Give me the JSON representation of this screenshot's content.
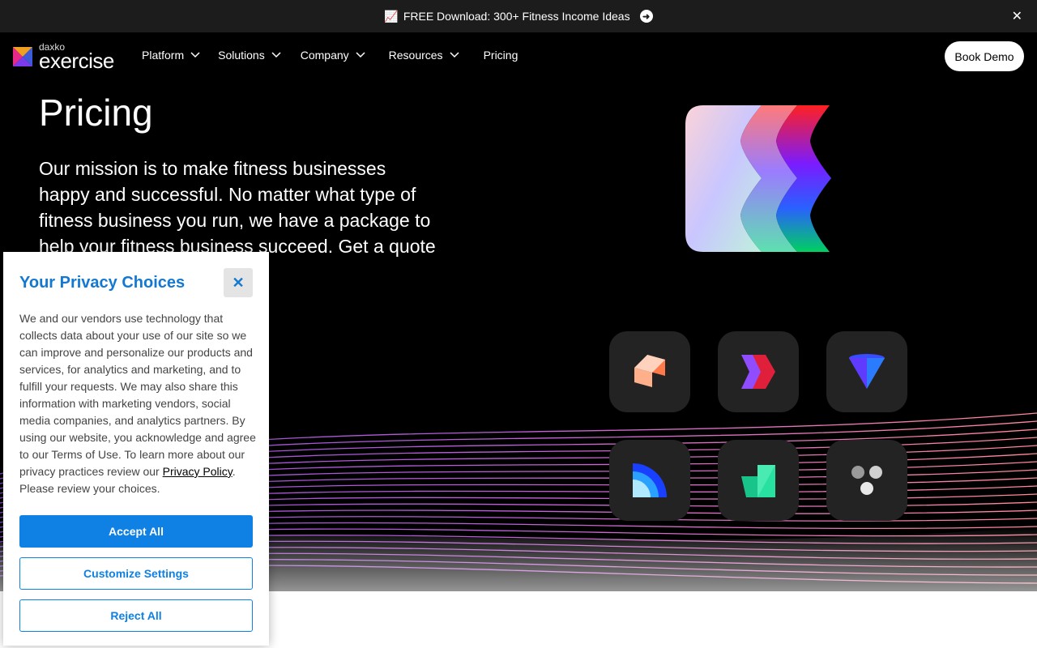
{
  "announcement": {
    "emoji": "📈",
    "text": "FREE Download: 300+ Fitness Income Ideas"
  },
  "logo": {
    "small": "daxko",
    "big": "exercise"
  },
  "nav": {
    "items": [
      {
        "label": "Platform",
        "dropdown": true
      },
      {
        "label": "Solutions",
        "dropdown": true
      },
      {
        "label": "Company",
        "dropdown": true
      },
      {
        "label": "Resources",
        "dropdown": true
      },
      {
        "label": "Pricing",
        "dropdown": false
      }
    ],
    "cta": "Book Demo"
  },
  "hero": {
    "title": "Pricing",
    "text": "Our mission is to make fitness businesses happy and successful. No matter what type of fitness business you run, we have a package to help your fitness business succeed. Get a quote"
  },
  "privacy": {
    "title": "Your Privacy Choices",
    "body_before_link": "We and our vendors use technology that collects data about your use of our site so we can improve and personalize our products and services, for analytics and marketing, and to fulfill your requests. We may also share this information with marketing vendors, social media companies, and analytics partners. By using our website, you acknowledge and agree to our Terms of Use. To learn more about our privacy practices review our ",
    "link": "Privacy Policy",
    "body_after_link": ". Please review your choices.",
    "accept": "Accept All",
    "customize": "Customize Settings",
    "reject": "Reject All"
  },
  "colors": {
    "accent_blue": "#0f80e4",
    "title_blue": "#1378d1",
    "tile_bg": "#232323"
  }
}
